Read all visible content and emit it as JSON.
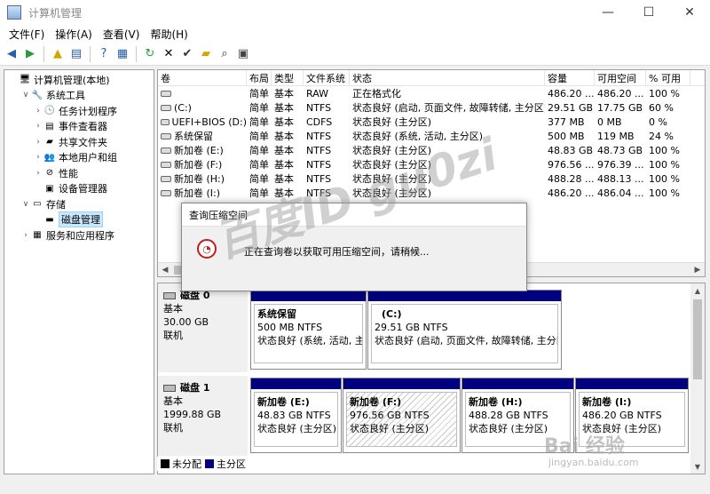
{
  "window": {
    "title": "计算机管理",
    "min": "—",
    "max": "☐",
    "close": "✕"
  },
  "menu": [
    "文件(F)",
    "操作(A)",
    "查看(V)",
    "帮助(H)"
  ],
  "tree": [
    {
      "label": "计算机管理(本地)",
      "indent": 0,
      "arrow": "",
      "icon": "computer-management-icon",
      "glyph": "🖥"
    },
    {
      "label": "系统工具",
      "indent": 1,
      "arrow": "∨",
      "icon": "system-tools-icon",
      "glyph": "🔧"
    },
    {
      "label": "任务计划程序",
      "indent": 2,
      "arrow": "›",
      "icon": "task-scheduler-icon",
      "glyph": "🕓"
    },
    {
      "label": "事件查看器",
      "indent": 2,
      "arrow": "›",
      "icon": "event-viewer-icon",
      "glyph": "▤"
    },
    {
      "label": "共享文件夹",
      "indent": 2,
      "arrow": "›",
      "icon": "shared-folders-icon",
      "glyph": "▰"
    },
    {
      "label": "本地用户和组",
      "indent": 2,
      "arrow": "›",
      "icon": "local-users-icon",
      "glyph": "👥"
    },
    {
      "label": "性能",
      "indent": 2,
      "arrow": "›",
      "icon": "performance-icon",
      "glyph": "⊘"
    },
    {
      "label": "设备管理器",
      "indent": 2,
      "arrow": "",
      "icon": "device-manager-icon",
      "glyph": "▣"
    },
    {
      "label": "存储",
      "indent": 1,
      "arrow": "∨",
      "icon": "storage-icon",
      "glyph": "▭"
    },
    {
      "label": "磁盘管理",
      "indent": 2,
      "arrow": "",
      "icon": "disk-management-icon",
      "glyph": "▬",
      "selected": true
    },
    {
      "label": "服务和应用程序",
      "indent": 1,
      "arrow": "›",
      "icon": "services-apps-icon",
      "glyph": "▦"
    }
  ],
  "volume_columns": [
    "卷",
    "布局",
    "类型",
    "文件系统",
    "状态",
    "容量",
    "可用空间",
    "% 可用"
  ],
  "volumes": [
    [
      "",
      "简单",
      "基本",
      "RAW",
      "正在格式化",
      "486.20 ...",
      "486.20 ...",
      "100 %"
    ],
    [
      "(C:)",
      "简单",
      "基本",
      "NTFS",
      "状态良好 (启动, 页面文件, 故障转储, 主分区)",
      "29.51 GB",
      "17.75 GB",
      "60 %"
    ],
    [
      "UEFI+BIOS (D:)",
      "简单",
      "基本",
      "CDFS",
      "状态良好 (主分区)",
      "377 MB",
      "0 MB",
      "0 %"
    ],
    [
      "系统保留",
      "简单",
      "基本",
      "NTFS",
      "状态良好 (系统, 活动, 主分区)",
      "500 MB",
      "119 MB",
      "24 %"
    ],
    [
      "新加卷 (E:)",
      "简单",
      "基本",
      "NTFS",
      "状态良好 (主分区)",
      "48.83 GB",
      "48.73 GB",
      "100 %"
    ],
    [
      "新加卷 (F:)",
      "简单",
      "基本",
      "NTFS",
      "状态良好 (主分区)",
      "976.56 ...",
      "976.39 ...",
      "100 %"
    ],
    [
      "新加卷 (H:)",
      "简单",
      "基本",
      "NTFS",
      "状态良好 (主分区)",
      "488.28 ...",
      "488.13 ...",
      "100 %"
    ],
    [
      "新加卷 (I:)",
      "简单",
      "基本",
      "NTFS",
      "状态良好 (主分区)",
      "486.20 ...",
      "486.04 ...",
      "100 %"
    ]
  ],
  "disks": [
    {
      "name": "磁盘 0",
      "type": "基本",
      "size": "30.00 GB",
      "state": "联机",
      "partitions": [
        {
          "name": "系统保留",
          "size": "500 MB NTFS",
          "status": "状态良好 (系统, 活动, 主分区)"
        },
        {
          "name": "(C:)",
          "size": "29.51 GB NTFS",
          "status": "状态良好 (启动, 页面文件, 故障转储, 主分区)"
        }
      ]
    },
    {
      "name": "磁盘 1",
      "type": "基本",
      "size": "1999.88 GB",
      "state": "联机",
      "partitions": [
        {
          "name": "新加卷  (E:)",
          "size": "48.83 GB NTFS",
          "status": "状态良好 (主分区)"
        },
        {
          "name": "新加卷  (F:)",
          "size": "976.56 GB NTFS",
          "status": "状态良好 (主分区)"
        },
        {
          "name": "新加卷  (H:)",
          "size": "488.28 GB NTFS",
          "status": "状态良好 (主分区)"
        },
        {
          "name": "新加卷  (I:)",
          "size": "486.20 GB NTFS",
          "status": "状态良好 (主分区)"
        }
      ]
    }
  ],
  "legend": [
    {
      "label": "未分配",
      "color": "#000000"
    },
    {
      "label": "主分区",
      "color": "#000080"
    }
  ],
  "dialog": {
    "title": "查询压缩空间",
    "message": "正在查询卷以获取可用压缩空间，请稍候..."
  },
  "watermark": {
    "text": "百度ID gu0zi",
    "brand": "Bai 经验",
    "sub": "jingyan.baidu.com"
  }
}
